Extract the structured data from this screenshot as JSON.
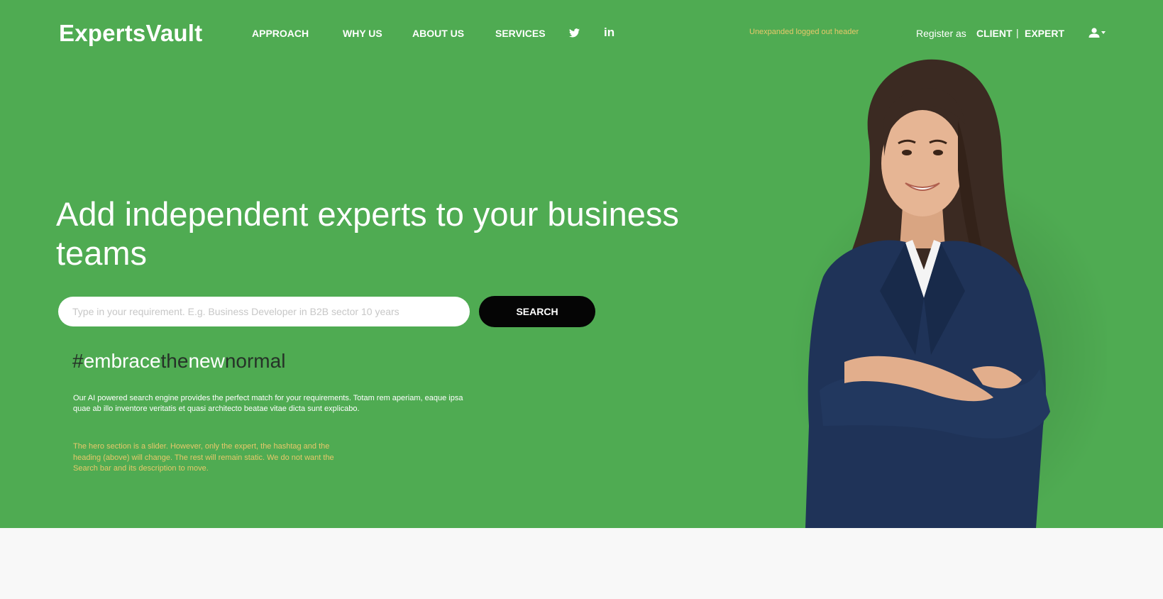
{
  "header": {
    "logo": "ExpertsVault",
    "nav": [
      "APPROACH",
      "WHY US",
      "ABOUT US",
      "SERVICES"
    ],
    "social_icons": [
      "twitter-icon",
      "linkedin-icon"
    ],
    "linkedin_text": "in",
    "note": "Unexpanded logged out header",
    "register_label": "Register as",
    "register_client": "CLIENT",
    "register_separator": "|",
    "register_expert": "EXPERT",
    "user_icon": "user-icon"
  },
  "hero": {
    "headline": "Add independent experts to your business teams",
    "search_placeholder": "Type in your requirement. E.g. Business Developer in B2B sector 10 years",
    "search_value": "",
    "search_button": "SEARCH",
    "hashtag": {
      "hash": "#",
      "w1": "embrace",
      "w2": "the",
      "w3": "new",
      "w4": "normal"
    },
    "description": "Our AI powered search engine provides the perfect match for your requirements. Totam rem aperiam, eaque ipsa quae ab illo inventore veritatis et quasi architecto beatae vitae dicta sunt explicabo.",
    "note": "The hero section is a slider. However, only the expert, the hashtag and the heading (above) will change. The rest will remain static. We do not want the Search bar and its description to move."
  },
  "colors": {
    "hero_background": "#4fab52",
    "search_button": "#050505",
    "annotation_text": "#e8c86a",
    "hashtag_dark": "#263228",
    "page_background": "#f8f8f8"
  }
}
